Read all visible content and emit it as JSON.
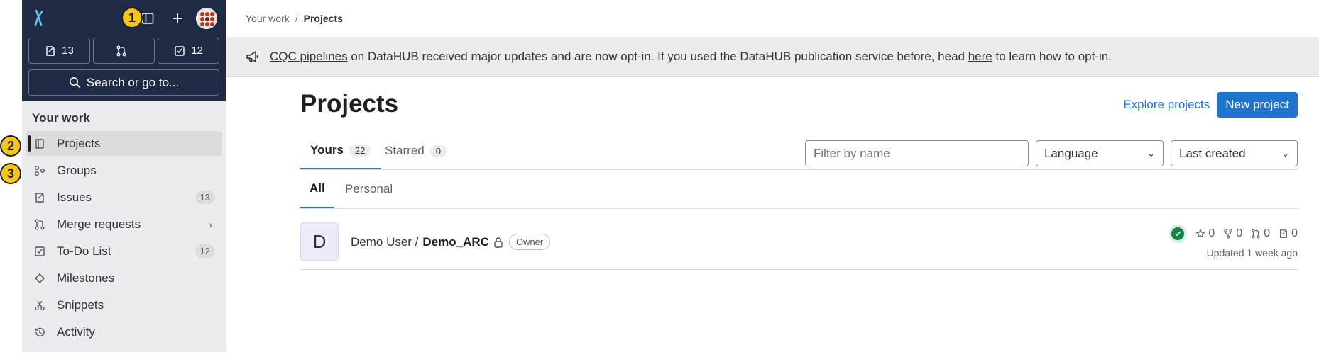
{
  "sidebar": {
    "counters": [
      {
        "icon": "issues-icon",
        "count": "13"
      },
      {
        "icon": "merge-request-icon",
        "count": ""
      },
      {
        "icon": "todo-icon",
        "count": "12"
      }
    ],
    "search_label": "Search or go to...",
    "section_title": "Your work",
    "items": [
      {
        "label": "Projects",
        "icon": "project-icon",
        "badge": "",
        "active": true
      },
      {
        "label": "Groups",
        "icon": "group-icon",
        "badge": ""
      },
      {
        "label": "Issues",
        "icon": "issues-icon",
        "badge": "13"
      },
      {
        "label": "Merge requests",
        "icon": "merge-request-icon",
        "badge": "",
        "chevron": true
      },
      {
        "label": "To-Do List",
        "icon": "todo-icon",
        "badge": "12"
      },
      {
        "label": "Milestones",
        "icon": "milestone-icon",
        "badge": ""
      },
      {
        "label": "Snippets",
        "icon": "snippet-icon",
        "badge": ""
      },
      {
        "label": "Activity",
        "icon": "history-icon",
        "badge": ""
      }
    ]
  },
  "markers": [
    "1",
    "2",
    "3"
  ],
  "breadcrumb": {
    "parent": "Your work",
    "separator": "/",
    "current": "Projects"
  },
  "banner": {
    "link1": "CQC pipelines",
    "text1": " on DataHUB received major updates and are now opt-in. If you used the DataHUB publication service before, head ",
    "link2": "here",
    "text2": " to learn how to opt-in."
  },
  "page": {
    "title": "Projects",
    "explore_label": "Explore projects",
    "new_label": "New project"
  },
  "tabs": [
    {
      "label": "Yours",
      "count": "22",
      "active": true
    },
    {
      "label": "Starred",
      "count": "0"
    }
  ],
  "filters": {
    "filter_placeholder": "Filter by name",
    "language_label": "Language",
    "sort_label": "Last created"
  },
  "subtabs": [
    {
      "label": "All",
      "active": true
    },
    {
      "label": "Personal"
    }
  ],
  "project": {
    "avatar_letter": "D",
    "namespace": "Demo User / ",
    "name": "Demo_ARC",
    "role": "Owner",
    "stars": "0",
    "forks": "0",
    "merge_requests": "0",
    "issues": "0",
    "updated": "Updated 1 week ago"
  },
  "colors": {
    "accent": "#1f75cb",
    "sidebar_top": "#1f2a44",
    "success": "#108548",
    "marker": "#f5c518"
  }
}
